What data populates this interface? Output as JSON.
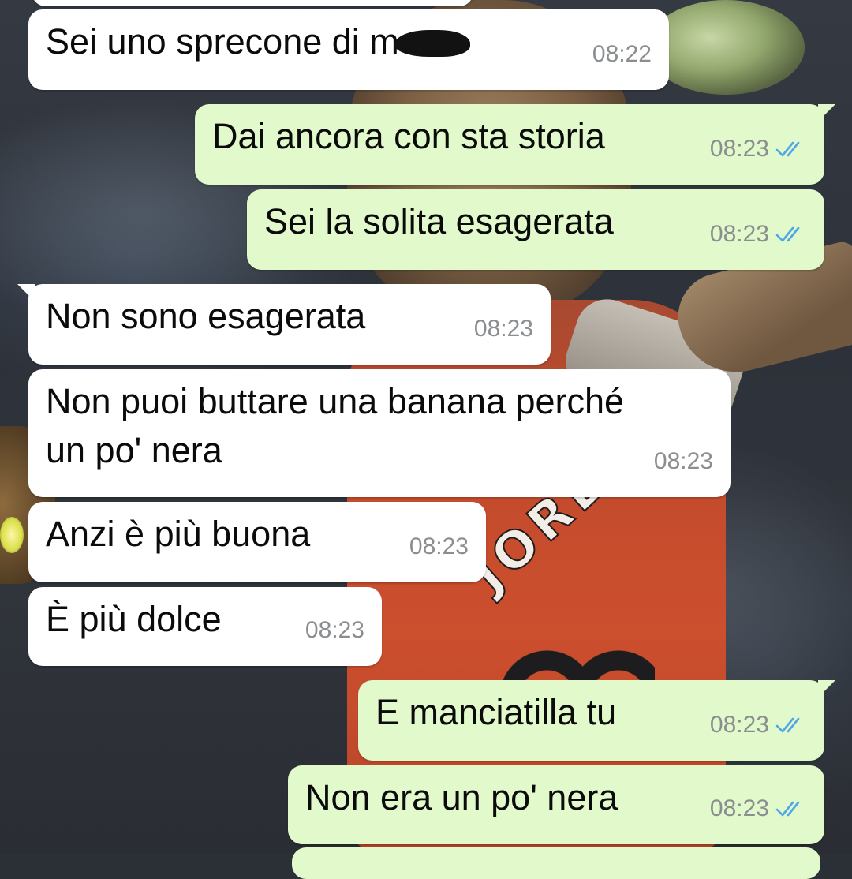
{
  "theme": {
    "incoming_bubble_color": "#ffffff",
    "outgoing_bubble_color": "#e1f9cb",
    "timestamp_color": "#8b8e90",
    "read_ticks_color": "#4fa6e8"
  },
  "wallpaper": {
    "jersey_text": "JORDA"
  },
  "messages": [
    {
      "direction": "incoming",
      "text": "Sei uno sprecone di m",
      "redacted_suffix": true,
      "time": "08:22"
    },
    {
      "direction": "outgoing",
      "text": "Dai ancora con sta storia",
      "time": "08:23",
      "status": "read"
    },
    {
      "direction": "outgoing",
      "text": "Sei la solita esagerata",
      "time": "08:23",
      "status": "read"
    },
    {
      "direction": "incoming",
      "text": "Non sono esagerata",
      "time": "08:23"
    },
    {
      "direction": "incoming",
      "text": "Non puoi buttare una banana perché\nun po' nera",
      "time": "08:23"
    },
    {
      "direction": "incoming",
      "text": "Anzi è più buona",
      "time": "08:23"
    },
    {
      "direction": "incoming",
      "text": "È più dolce",
      "time": "08:23"
    },
    {
      "direction": "outgoing",
      "text": "E manciatilla tu",
      "time": "08:23",
      "status": "read"
    },
    {
      "direction": "outgoing",
      "text": "Non era un po' nera",
      "time": "08:23",
      "status": "read"
    }
  ]
}
